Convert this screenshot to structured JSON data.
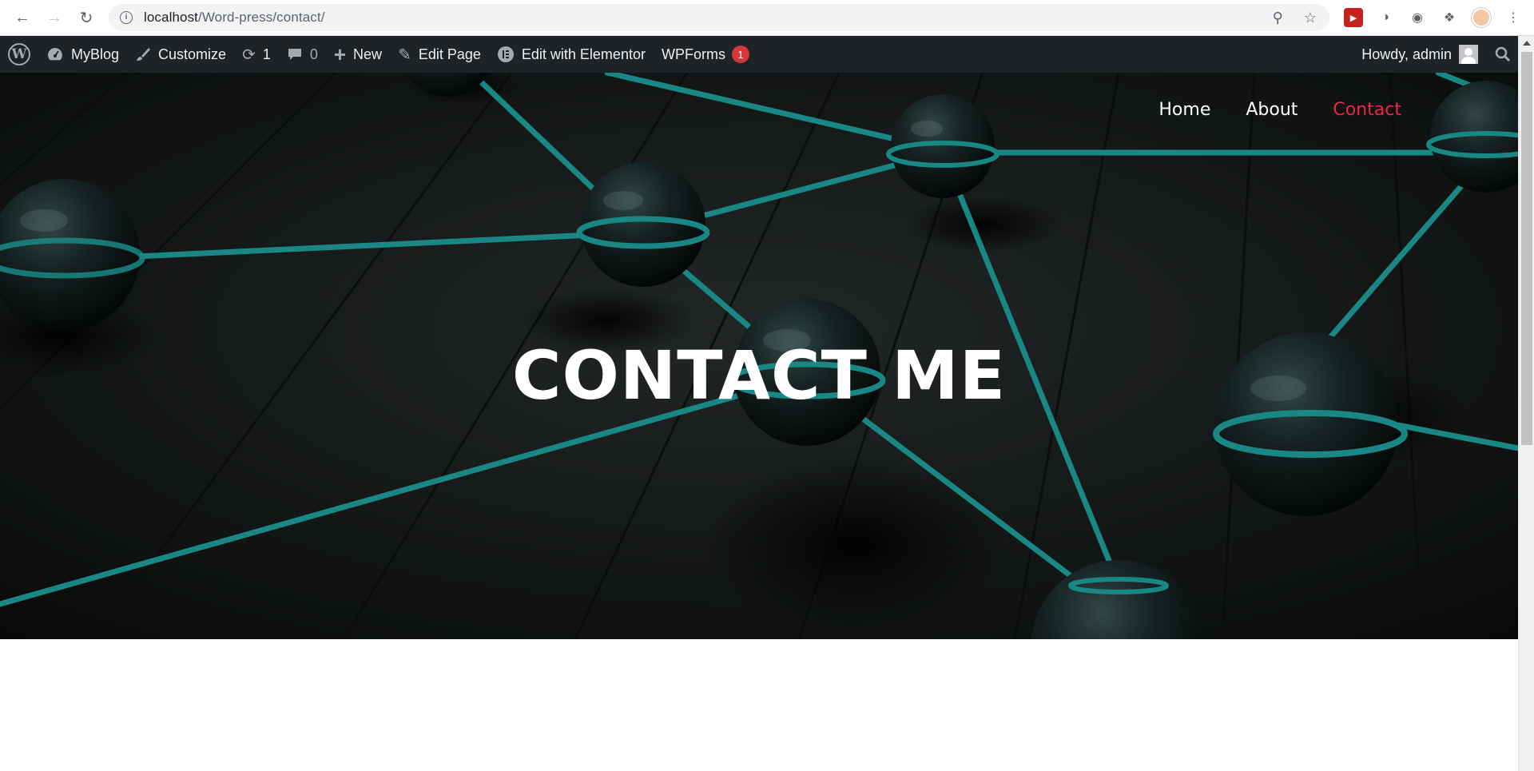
{
  "browser": {
    "url_host": "localhost",
    "url_path": "/Word-press/contact/"
  },
  "adminbar": {
    "site_name": "MyBlog",
    "customize": "Customize",
    "updates_count": "1",
    "comments_count": "0",
    "new": "New",
    "edit_page": "Edit Page",
    "edit_elementor": "Edit with Elementor",
    "wpforms": "WPForms",
    "wpforms_badge": "1",
    "howdy": "Howdy, admin"
  },
  "site_nav": {
    "items": [
      {
        "label": "Home",
        "active": false
      },
      {
        "label": "About",
        "active": false
      },
      {
        "label": "Contact",
        "active": true
      }
    ]
  },
  "hero": {
    "title": "CONTACT ME"
  },
  "colors": {
    "accent": "#e8264e",
    "network_line": "#1fa7a3",
    "adminbar_bg": "#1d2327"
  }
}
